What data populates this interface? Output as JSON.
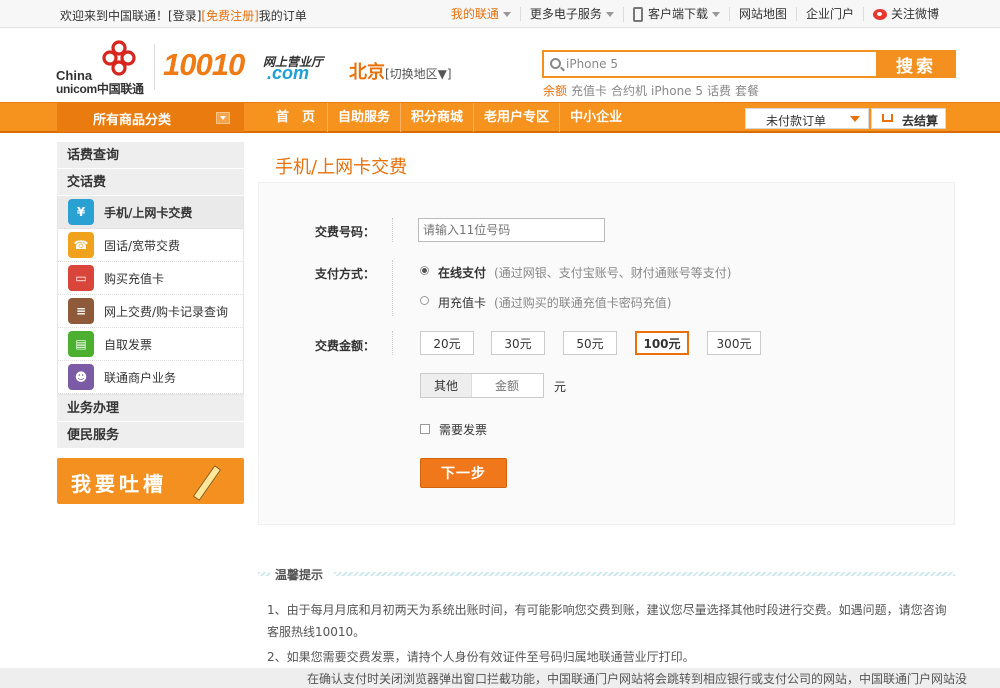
{
  "topbar": {
    "welcome": "欢迎来到中国联通！",
    "login": "[登录]",
    "register": "[免费注册]",
    "my_orders": "我的订单",
    "my_unicom": "我的联通",
    "more_services": "更多电子服务",
    "client_download": "客户端下载",
    "site_map": "网站地图",
    "enterprise_portal": "企业门户",
    "follow_weibo": "关注微博"
  },
  "header": {
    "logo_line1": "China",
    "logo_line2": "unicom中国联通",
    "brand_number": "10010",
    "brand_sub": "网上营业厅",
    "brand_com": ".com",
    "city": "北京",
    "city_switch": "[切换地区▼]"
  },
  "search": {
    "value": "iPhone 5",
    "button": "搜索",
    "hotwords": [
      "余额",
      "充值卡",
      "合约机",
      "iPhone 5",
      "话费",
      "套餐"
    ]
  },
  "nav": {
    "all_categories": "所有商品分类",
    "links": [
      "首　页",
      "自助服务",
      "积分商城",
      "老用户专区",
      "中小企业"
    ],
    "unpaid_orders": "未付款订单",
    "checkout": "去结算"
  },
  "sidebar": {
    "sections": [
      "话费查询",
      "交话费",
      "业务办理",
      "便民服务"
    ],
    "items": [
      {
        "label": "手机/上网卡交费",
        "icon": "mobile-payment-icon",
        "color": "#2aa1d3"
      },
      {
        "label": "固话/宽带交费",
        "icon": "telephone-icon",
        "color": "#f0a21d"
      },
      {
        "label": "购买充值卡",
        "icon": "recharge-card-icon",
        "color": "#d9453b"
      },
      {
        "label": "网上交费/购卡记录查询",
        "icon": "record-query-icon",
        "color": "#8e5a3a"
      },
      {
        "label": "自取发票",
        "icon": "invoice-icon",
        "color": "#4caf30"
      },
      {
        "label": "联通商户业务",
        "icon": "merchant-icon",
        "color": "#7b5aa6"
      }
    ],
    "feedback_banner": "我要吐槽"
  },
  "main": {
    "title": "手机/上网卡交费",
    "form": {
      "number_label": "交费号码：",
      "number_placeholder": "请输入11位号码",
      "pay_method_label": "支付方式：",
      "pay_online": "在线支付",
      "pay_online_hint": "(通过网银、支付宝账号、财付通账号等支付)",
      "pay_card": "用充值卡",
      "pay_card_hint": "(通过购买的联通充值卡密码充值)",
      "amount_label": "交费金额：",
      "amounts": [
        "20元",
        "30元",
        "50元",
        "100元",
        "300元"
      ],
      "selected_amount": "100元",
      "other_label": "其他",
      "other_placeholder": "金额",
      "unit": "元",
      "invoice_label": "需要发票",
      "next_button": "下一步"
    },
    "tips": {
      "title": "温馨提示",
      "items": [
        "1、由于每月月底和月初两天为系统出账时间，有可能影响您交费到账，建议您尽量选择其他时段进行交费。如遇问题，请您咨询客服热线10010。",
        "2、如果您需要交费发票，请持个人身份有效证件至号码归属地联通营业厅打印。"
      ]
    },
    "bottom_notice": "在确认支付时关闭浏览器弹出窗口拦截功能，中国联通门户网站将会跳转到相应银行或支付公司的网站，中国联通门户网站没"
  },
  "colors": {
    "accent": "#f39020",
    "nav_bg": "#f6921e",
    "title": "#e8710b"
  }
}
